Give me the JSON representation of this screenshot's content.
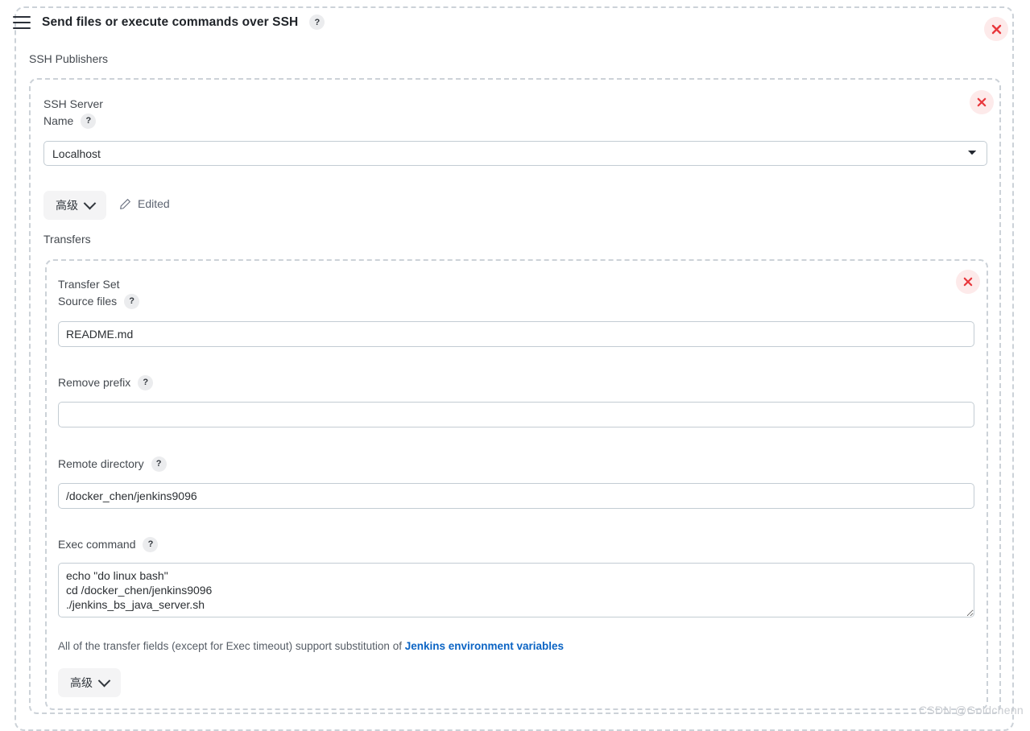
{
  "header": {
    "menu_icon": "hamburger-icon",
    "title": "Send files or execute commands over SSH",
    "help": "?",
    "close": "×"
  },
  "publishers": {
    "label": "SSH Publishers"
  },
  "ssh_server": {
    "title_line1": "SSH Server",
    "title_line2": "Name",
    "help": "?",
    "selected": "Localhost",
    "options": [
      "Localhost"
    ],
    "advanced_label": "高级",
    "edited_label": "Edited",
    "edit_icon": "pencil-icon",
    "transfers_label": "Transfers",
    "close": "×"
  },
  "transfer_set": {
    "title_line1": "Transfer Set",
    "title_line2": "Source files",
    "help": "?",
    "close": "×",
    "source_files": {
      "label": "Source files",
      "value": "README.md",
      "placeholder": ""
    },
    "remove_prefix": {
      "label": "Remove prefix",
      "help": "?",
      "value": "",
      "placeholder": ""
    },
    "remote_directory": {
      "label": "Remote directory",
      "help": "?",
      "value": "/docker_chen/jenkins9096",
      "placeholder": ""
    },
    "exec_command": {
      "label": "Exec command",
      "help": "?",
      "value": "echo \"do linux bash\"\ncd /docker_chen/jenkins9096\n./jenkins_bs_java_server.sh",
      "placeholder": ""
    },
    "note_prefix": "All of the transfer fields (except for Exec timeout) support substitution of ",
    "note_link": "Jenkins environment variables",
    "advanced_label": "高级"
  },
  "watermark": "CSDN @Goldchenn",
  "colors": {
    "accent_link": "#0b64c4",
    "danger": "#e8373c",
    "danger_bg": "#fdeaea",
    "dashed_border": "#ccd2d8",
    "input_border": "#c3ccd3"
  }
}
